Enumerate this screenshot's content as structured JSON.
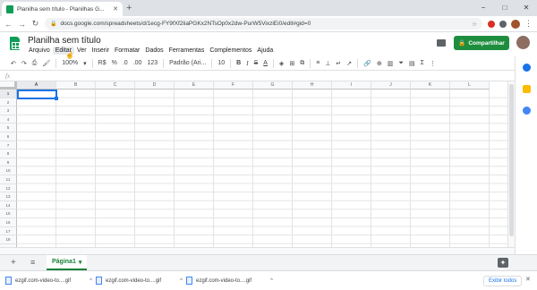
{
  "browser": {
    "tab_title": "Planilha sem título - Planilhas G...",
    "tab_close": "✕",
    "new_tab": "+",
    "url": "docs.google.com/spreadsheets/d/1ecg-FY9fXf2liaPGKx2NTsOp0x2dw-PurW5VixziEi0/edit#gid=0",
    "window_controls": [
      "−",
      "□",
      "✕"
    ]
  },
  "sheets": {
    "title": "Planilha sem título",
    "menus": [
      "Arquivo",
      "Editar",
      "Ver",
      "Inserir",
      "Formatar",
      "Dados",
      "Ferramentas",
      "Complementos",
      "Ajuda"
    ],
    "highlighted_menu": "Editar",
    "share_label": "Compartilhar",
    "share_icon": "lock-icon"
  },
  "format_toolbar": {
    "zoom": "100%",
    "currency": "R$",
    "percent": "%",
    "decimal_less": ".0",
    "decimal_more": ".00",
    "number_format": "123",
    "font": "Padrão (Ari...",
    "font_size": "10",
    "bold": "B",
    "italic": "I",
    "strike": "S",
    "text_color": "A",
    "sigma": "Σ"
  },
  "formula_bar": {
    "fx": "fx"
  },
  "grid": {
    "columns": [
      "A",
      "B",
      "C",
      "D",
      "E",
      "F",
      "G",
      "H",
      "I",
      "J",
      "K",
      "L"
    ],
    "rows": [
      "1",
      "2",
      "3",
      "4",
      "5",
      "6",
      "7",
      "8",
      "9",
      "10",
      "11",
      "12",
      "13",
      "14",
      "15",
      "16",
      "17",
      "18",
      "19"
    ],
    "selected_cell": "A1"
  },
  "sheet_bar": {
    "add": "+",
    "list": "≡",
    "active_sheet": "Página1",
    "arrow": "▾"
  },
  "downloads": {
    "items": [
      {
        "name": "ezgif.com-video-to....gif"
      },
      {
        "name": "ezgif.com-video-to....gif"
      },
      {
        "name": "ezgif.com-video-to....gif"
      }
    ],
    "show_all": "Exibir todos",
    "close": "✕"
  },
  "colors": {
    "accent_green": "#1e8e3e",
    "selection_blue": "#1a73e8",
    "sheets_logo": "#0f9d58"
  }
}
